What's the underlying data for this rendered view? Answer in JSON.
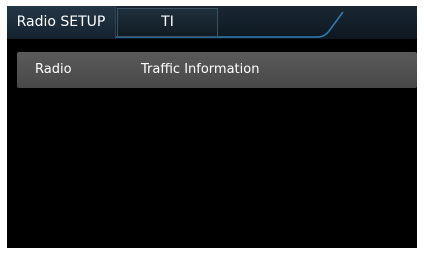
{
  "header": {
    "title": "Radio SETUP",
    "tab_label": "TI"
  },
  "settings": [
    {
      "label": "Radio",
      "value": "Traffic Information"
    }
  ],
  "colors": {
    "screen_background": "#000000",
    "header_background": "#14222e",
    "accent_line": "#2f7fb8",
    "row_background": "#505050",
    "text": "#ffffff"
  }
}
